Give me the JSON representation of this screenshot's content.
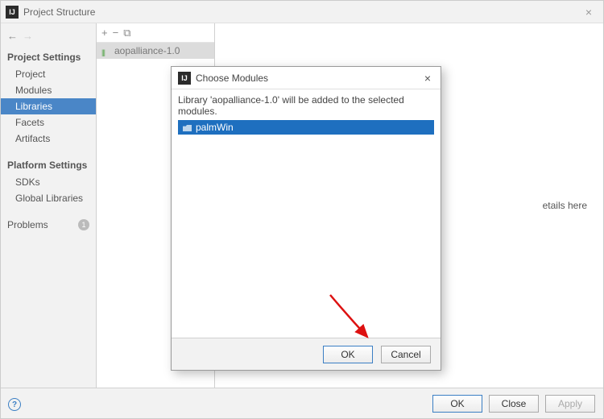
{
  "window": {
    "title": "Project Structure",
    "close_glyph": "×"
  },
  "nav": {
    "back": "←",
    "forward": "→"
  },
  "sidebar": {
    "project_settings_header": "Project Settings",
    "project": "Project",
    "modules": "Modules",
    "libraries": "Libraries",
    "facets": "Facets",
    "artifacts": "Artifacts",
    "platform_settings_header": "Platform Settings",
    "sdks": "SDKs",
    "global_libraries": "Global Libraries",
    "problems": "Problems",
    "problems_count": "1"
  },
  "libraries_list": {
    "toolbar": {
      "add": "+",
      "remove": "−",
      "copy": "⧉"
    },
    "items": [
      {
        "label": "aopalliance-1.0"
      }
    ]
  },
  "detail": {
    "hint_suffix": "etails here"
  },
  "footer": {
    "ok": "OK",
    "cancel": "Close",
    "apply": "Apply"
  },
  "modal": {
    "title": "Choose Modules",
    "message": "Library 'aopalliance-1.0' will be added to the selected modules.",
    "items": [
      {
        "label": "palmWin"
      }
    ],
    "ok": "OK",
    "cancel": "Cancel",
    "close_glyph": "×"
  }
}
